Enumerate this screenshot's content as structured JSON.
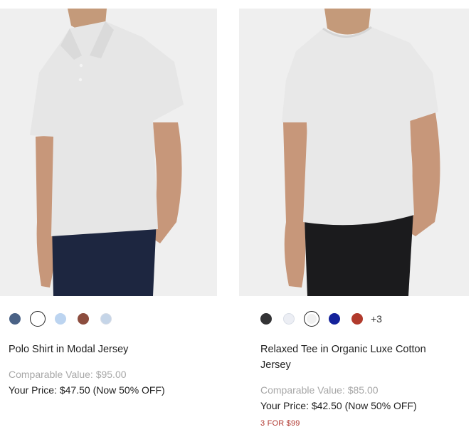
{
  "products": [
    {
      "name": "Polo Shirt in Modal Jersey",
      "comparable_value": "Comparable Value: $95.00",
      "your_price": "Your Price: $47.50 (Now 50% OFF)",
      "swatches": [
        {
          "color": "#4a6286",
          "label": "navy-blue"
        },
        {
          "color": "#ffffff",
          "label": "white",
          "selected": true
        },
        {
          "color": "#bcd4f0",
          "label": "light-blue"
        },
        {
          "color": "#8c4d3e",
          "label": "rust-brown"
        },
        {
          "color": "#c5d5e8",
          "label": "pale-blue"
        }
      ],
      "image": {
        "shirt_color": "#e6e6e6",
        "pants_color": "#1d2640"
      }
    },
    {
      "name": "Relaxed Tee in Organic Luxe Cotton Jersey",
      "comparable_value": "Comparable Value: $85.00",
      "your_price": "Your Price: $42.50 (Now 50% OFF)",
      "promo": "3 FOR $99",
      "swatches": [
        {
          "color": "#333335",
          "label": "black"
        },
        {
          "color": "#eceef4",
          "label": "off-white"
        },
        {
          "color": "#f1f1f1",
          "label": "light-grey",
          "selected": true
        },
        {
          "color": "#14229b",
          "label": "royal-blue"
        },
        {
          "color": "#b13a2c",
          "label": "red"
        }
      ],
      "more_colors": "+3",
      "image": {
        "shirt_color": "#e8e8e8",
        "pants_color": "#1b1b1d"
      }
    }
  ]
}
